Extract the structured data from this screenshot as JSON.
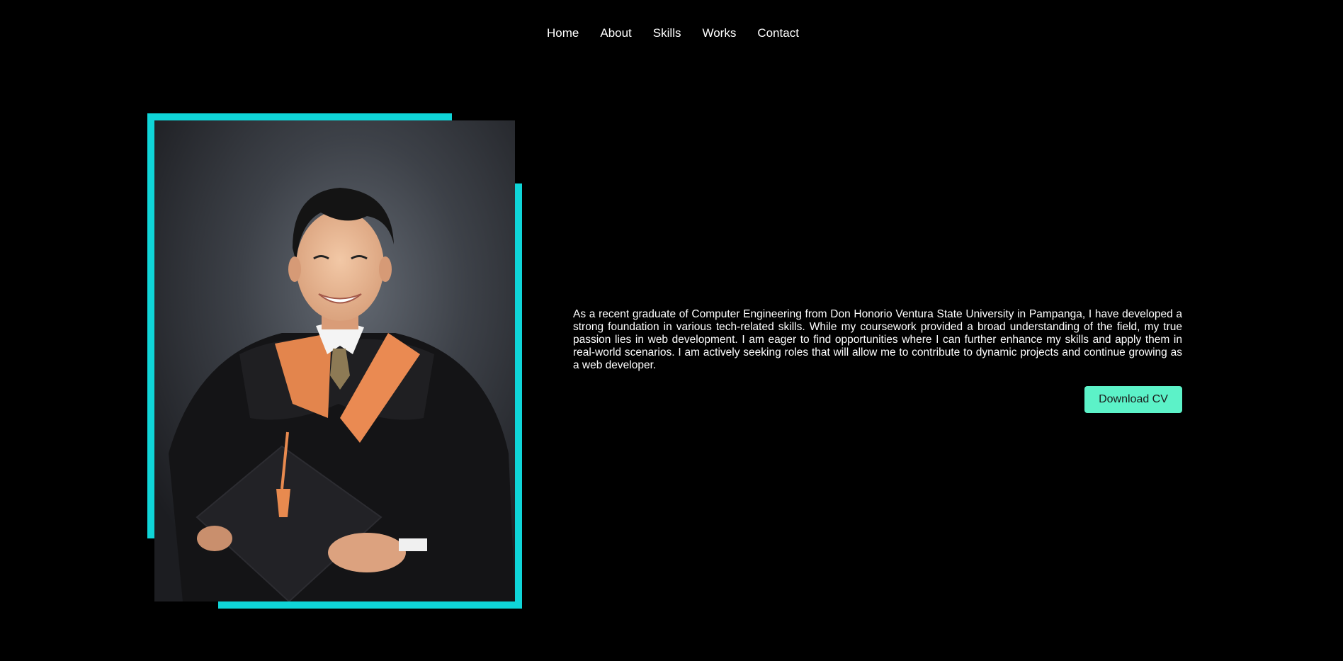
{
  "nav": {
    "items": [
      {
        "label": "Home"
      },
      {
        "label": "About"
      },
      {
        "label": "Skills"
      },
      {
        "label": "Works"
      },
      {
        "label": "Contact"
      }
    ]
  },
  "about": {
    "paragraph": "As a recent graduate of Computer Engineering from Don Honorio Ventura State University in Pampanga, I have developed a strong foundation in various tech-related skills. While my coursework provided a broad understanding of the field, my true passion lies in web development. I am eager to find opportunities where I can further enhance my skills and apply them in real-world scenarios. I am actively seeking roles that will allow me to contribute to dynamic projects and continue growing as a web developer.",
    "cv_button_label": "Download CV"
  },
  "colors": {
    "background": "#000000",
    "frame_accent": "#0fd5d8",
    "button_bg": "#5cf2c8",
    "text": "#ffffff"
  }
}
